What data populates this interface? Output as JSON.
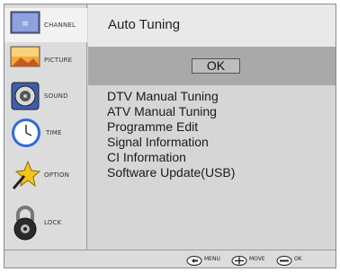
{
  "sidebar": {
    "items": [
      {
        "label": "CHANNEL",
        "icon": "channel-icon",
        "active": true
      },
      {
        "label": "PICTURE",
        "icon": "picture-icon",
        "active": false
      },
      {
        "label": "SOUND",
        "icon": "sound-icon",
        "active": false
      },
      {
        "label": "TIME",
        "icon": "clock-icon",
        "active": false
      },
      {
        "label": "OPTION",
        "icon": "option-icon",
        "active": false
      },
      {
        "label": "LOCK",
        "icon": "lock-icon",
        "active": false
      }
    ]
  },
  "main": {
    "title": "Auto Tuning",
    "ok_label": "OK",
    "menu": [
      "DTV Manual Tuning",
      "ATV Manual Tuning",
      "Programme Edit",
      "Signal Information",
      "CI Information",
      "Software Update(USB)"
    ]
  },
  "footer": {
    "menu_label": "MENU",
    "move_label": "MOVE",
    "ok_label": "OK"
  },
  "colors": {
    "panel": "#d6d6d6",
    "selection_band": "#a9a9a9",
    "text": "#1a1a1a"
  }
}
